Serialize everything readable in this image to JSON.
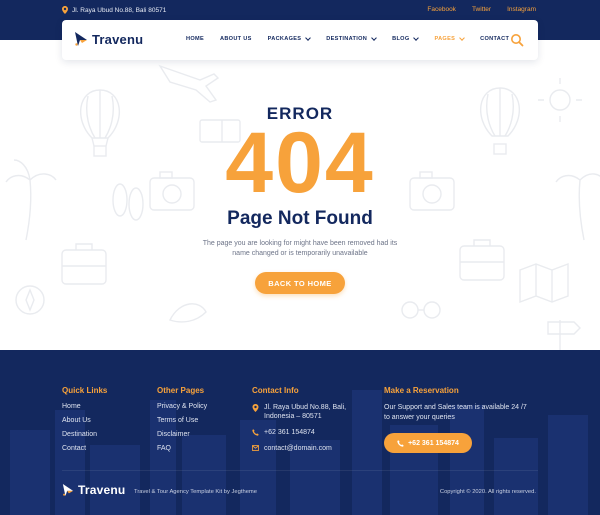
{
  "colors": {
    "navy": "#13285e",
    "accent": "#f7a23b",
    "muted": "#6d7488"
  },
  "topbar": {
    "address": "Jl. Raya Ubud No.88, Bali 80571",
    "social": [
      "Facebook",
      "Twitter",
      "Instagram"
    ]
  },
  "header": {
    "logo": "Travenu",
    "nav": [
      {
        "label": "HOME",
        "dropdown": false
      },
      {
        "label": "ABOUT US",
        "dropdown": false
      },
      {
        "label": "PACKAGES",
        "dropdown": true
      },
      {
        "label": "DESTINATION",
        "dropdown": true
      },
      {
        "label": "BLOG",
        "dropdown": true
      },
      {
        "label": "PAGES",
        "dropdown": true,
        "active": true
      },
      {
        "label": "CONTACT",
        "dropdown": false
      }
    ],
    "search_icon": "search-icon"
  },
  "error": {
    "label": "ERROR",
    "code": "404",
    "title": "Page Not Found",
    "message": "The page you are looking for might have been removed had its name changed or is temporarily unavailable",
    "button": "BACK TO HOME"
  },
  "footer": {
    "quick_links": {
      "heading": "Quick Links",
      "items": [
        "Home",
        "About Us",
        "Destination",
        "Contact"
      ]
    },
    "other_pages": {
      "heading": "Other Pages",
      "items": [
        "Privacy & Policy",
        "Terms of Use",
        "Disclaimer",
        "FAQ"
      ]
    },
    "contact_info": {
      "heading": "Contact Info",
      "address": "Jl. Raya Ubud No.88, Bali, Indonesia – 80571",
      "phone": "+62 361 154874",
      "email": "contact@domain.com"
    },
    "reservation": {
      "heading": "Make a Reservation",
      "text": "Our Support and Sales team is available 24 /7 to answer your queries",
      "button": "+62 361 154874"
    },
    "logo": "Travenu",
    "tagline": "Travel & Tour Agency Template Kit by Jegtheme",
    "copyright": "Copyright © 2020. All rights reserved."
  }
}
